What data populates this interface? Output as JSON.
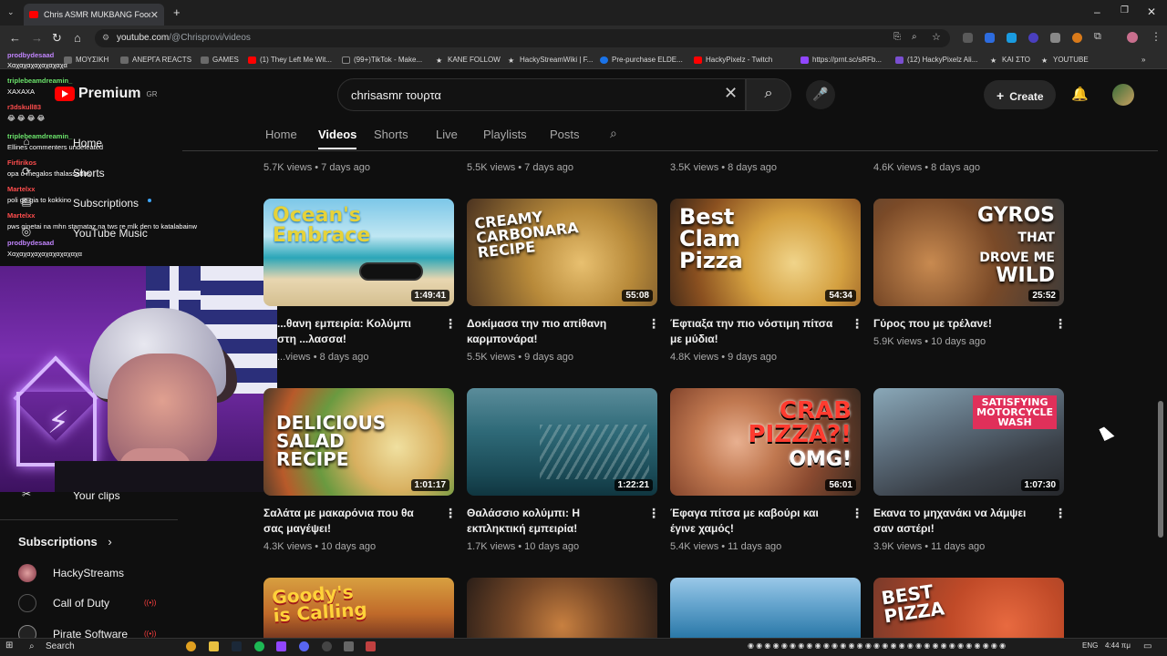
{
  "browser": {
    "tab_title": "Chris ASMR MUKBANG Food /",
    "url_domain": "youtube.com",
    "url_path": "/@Chrisprovi/videos",
    "bookmarks": [
      "ΜΟΥΣΙΚΗ",
      "ΑΝΕΡΓΑ REACTS",
      "GAMES",
      "(1) They Left Me Wit...",
      "(99+)TikTok - Make...",
      "KANE FOLLOW",
      "HackyStreamWiki | F...",
      "Pre-purchase ELDE...",
      "HackyPixelz - Twitch",
      "https://prnt.sc/sRFb...",
      "(12) HackyPixelz Ali...",
      "ΚΑΙ ΣΤΟ",
      "YOUTUBE"
    ]
  },
  "header": {
    "logo_text": "Premium",
    "region": "GR",
    "search_value": "chrisasmr τουρτα",
    "create_label": "Create"
  },
  "channel_tabs": [
    "Home",
    "Videos",
    "Shorts",
    "Live",
    "Playlists",
    "Posts"
  ],
  "nav": {
    "items": [
      "Home",
      "Shorts",
      "Subscriptions",
      "YouTube Music"
    ],
    "your_clips": "Your clips",
    "subscriptions_heading": "Subscriptions",
    "subscriptions": [
      "HackyStreams",
      "Call of Duty",
      "Pirate Software"
    ]
  },
  "chat": [
    {
      "name": "",
      "msg": "Χαχαχαχαχαχαχαχα"
    },
    {
      "name": "prodbydesaad",
      "msg": ""
    },
    {
      "name": "triplebeamdreamin_",
      "msg": "ΧΑΧΑΧΑ"
    },
    {
      "name": "r3dskull83",
      "msg": "😂 😂 😂 😂"
    },
    {
      "name": "triplebeamdreamin_",
      "msg": "Ellines commenters undefeated"
    },
    {
      "name": "Firfirikos",
      "msg": "opa o megalos thalassaftos"
    },
    {
      "name": "Martelxx",
      "msg": "poli ge gia to kokkino"
    },
    {
      "name": "Martelxx",
      "msg": "pws ginetai na mhn stamataz na tws re mlk den to katalabainw"
    },
    {
      "name": "prodbydesaad",
      "msg": "Χαχαχαχαχαχαχαχαχαχα"
    }
  ],
  "prev_row": [
    {
      "views": "5.7K views",
      "age": "7 days ago"
    },
    {
      "views": "5.5K views",
      "age": "7 days ago"
    },
    {
      "views": "3.5K views",
      "age": "8 days ago"
    },
    {
      "views": "4.6K views",
      "age": "8 days ago"
    }
  ],
  "videos": [
    {
      "title": "Μια απίθανη εμπειρία: Κολύμπι στη θάλασσα!",
      "title_visible": "...θανη εμπειρία: Κολύμπι στη ...λασσα!",
      "views": "...views",
      "age": "8 days ago",
      "duration": "1:49:41",
      "overlay": "Ocean's Embrace"
    },
    {
      "title": "Δοκίμασα την πιο απίθανη καρμπονάρα!",
      "views": "5.5K views",
      "age": "9 days ago",
      "duration": "55:08",
      "overlay": "CREAMY CARBONARA RECIPE"
    },
    {
      "title": "Έφτιαξα την πιο νόστιμη πίτσα με μύδια!",
      "views": "4.8K views",
      "age": "9 days ago",
      "duration": "54:34",
      "overlay": "Best Clam Pizza"
    },
    {
      "title": "Γύρος που με τρέλανε!",
      "views": "5.9K views",
      "age": "10 days ago",
      "duration": "25:52",
      "overlay": "GYROS THAT DROVE ME WILD"
    },
    {
      "title": "Σαλάτα με μακαρόνια που θα σας μαγέψει!",
      "views": "4.3K views",
      "age": "10 days ago",
      "duration": "1:01:17",
      "overlay": "DELICIOUS SALAD RECIPE"
    },
    {
      "title": "Θαλάσσιο κολύμπι: Η εκπληκτική εμπειρία!",
      "views": "1.7K views",
      "age": "10 days ago",
      "duration": "1:22:21",
      "overlay": ""
    },
    {
      "title": "Έφαγα πίτσα με καβούρι και έγινε χαμός!",
      "views": "5.4K views",
      "age": "11 days ago",
      "duration": "56:01",
      "overlay": "CRAB PIZZA?! OMG!"
    },
    {
      "title": "Εκανα το μηχανάκι να λάμψει σαν αστέρι!",
      "views": "3.9K views",
      "age": "11 days ago",
      "duration": "1:07:30",
      "overlay": "SATISFYING MOTORCYCLE WASH"
    }
  ],
  "next_row_overlays": [
    "Goody's is Calling",
    "",
    "",
    "BEST PIZZA"
  ],
  "taskbar": {
    "search_label": "Search",
    "lang": "ENG",
    "time": "4:44 πμ"
  },
  "colors": {
    "accent": "#ff0000",
    "bg": "#0f0f0f"
  }
}
